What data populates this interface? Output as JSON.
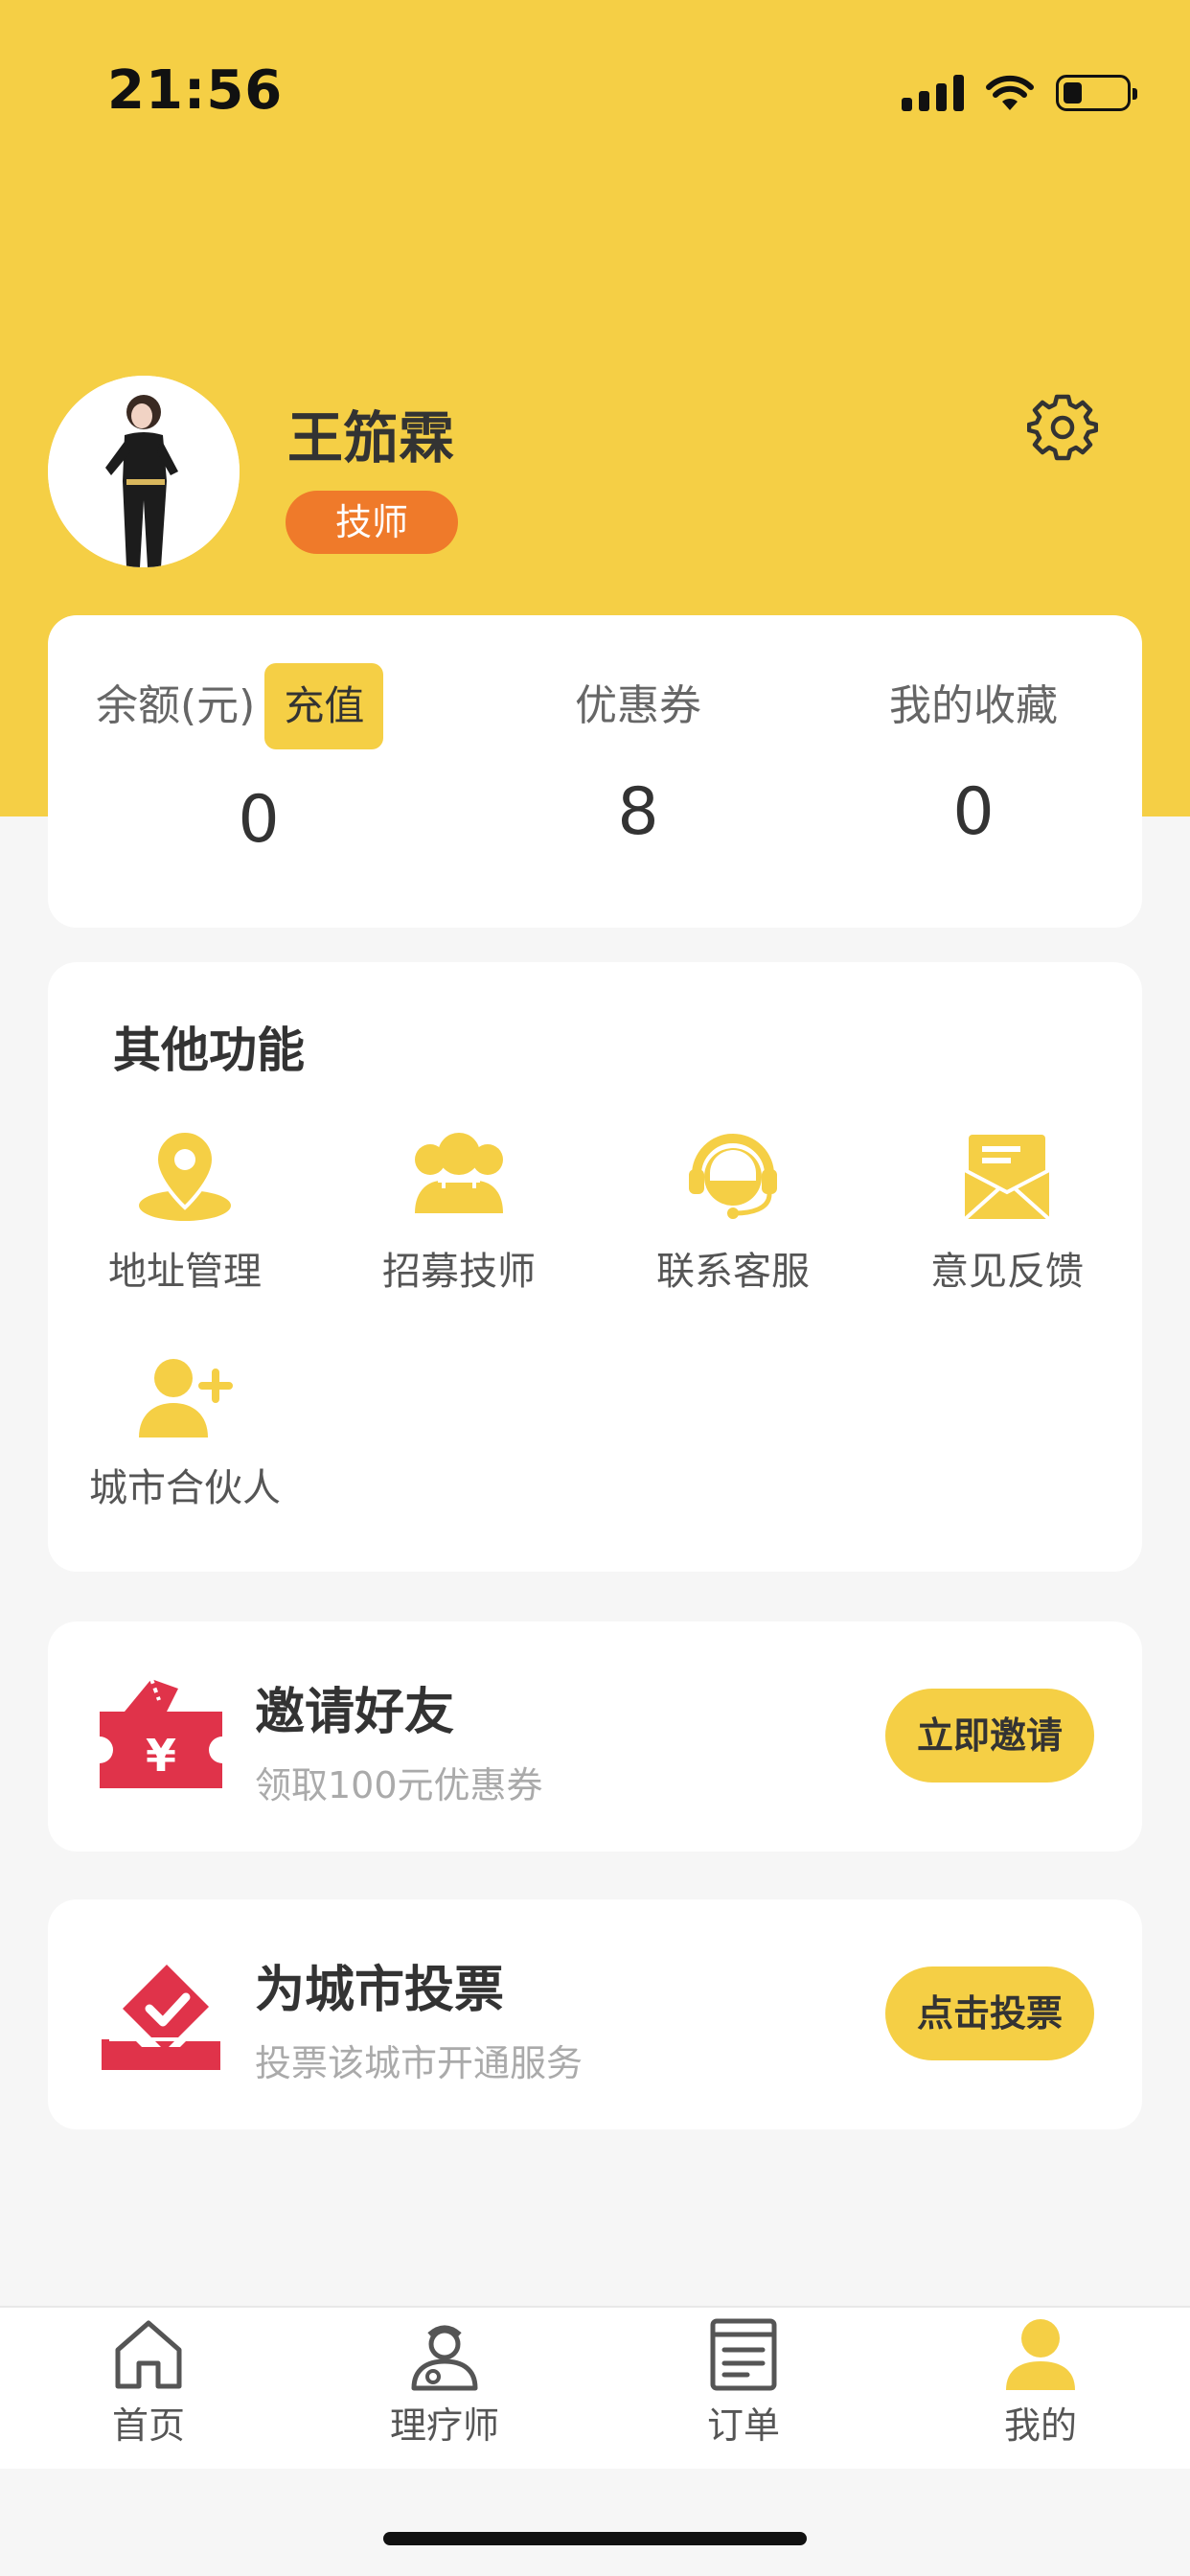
{
  "status_bar": {
    "time": "21:56",
    "battery_level": 0.3
  },
  "profile": {
    "name": "王笳霖",
    "role": "技师",
    "settings_icon": "gear-icon"
  },
  "stats": {
    "balance_label": "余额(元)",
    "recharge_label": "充值",
    "balance_value": "0",
    "coupon_label": "优惠券",
    "coupon_value": "8",
    "favorites_label": "我的收藏",
    "favorites_value": "0"
  },
  "functions": {
    "title": "其他功能",
    "items": [
      {
        "label": "地址管理",
        "icon": "location-pin-icon"
      },
      {
        "label": "招募技师",
        "icon": "users-icon"
      },
      {
        "label": "联系客服",
        "icon": "headset-icon"
      },
      {
        "label": "意见反馈",
        "icon": "mail-icon"
      },
      {
        "label": "城市合伙人",
        "icon": "add-user-icon"
      }
    ]
  },
  "invite": {
    "title": "邀请好友",
    "subtitle": "领取100元优惠券",
    "button": "立即邀请",
    "icon": "coupon-ticket-icon"
  },
  "vote": {
    "title": "为城市投票",
    "subtitle": "投票该城市开通服务",
    "button": "点击投票",
    "icon": "ballot-box-icon"
  },
  "tabbar": {
    "items": [
      {
        "label": "首页",
        "icon": "home-icon"
      },
      {
        "label": "理疗师",
        "icon": "therapist-icon"
      },
      {
        "label": "订单",
        "icon": "order-list-icon"
      },
      {
        "label": "我的",
        "icon": "profile-icon"
      }
    ],
    "active_index": 3
  },
  "colors": {
    "brand_yellow": "#f5cf45",
    "badge_orange": "#ef7a2a",
    "promo_red": "#e0334a"
  }
}
